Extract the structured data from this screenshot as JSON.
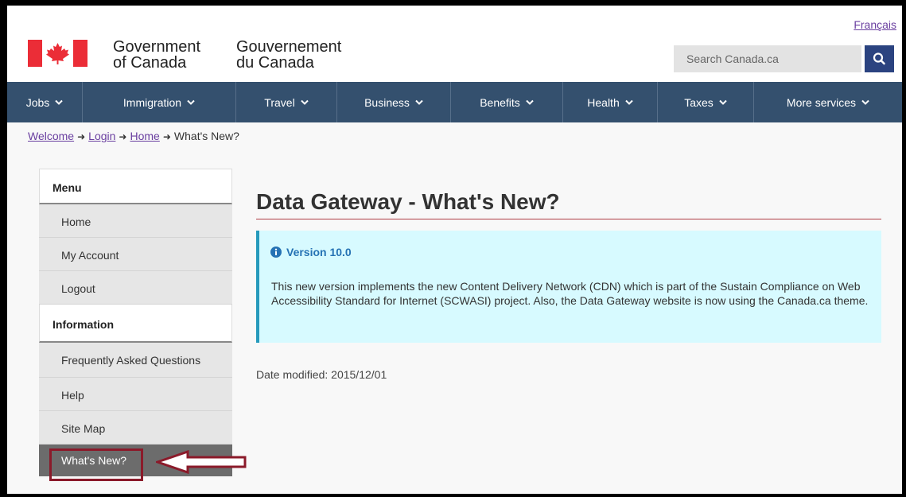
{
  "header": {
    "language_toggle": "Français",
    "signature_en": [
      "Government",
      "of Canada"
    ],
    "signature_fr": [
      "Gouvernement",
      "du Canada"
    ],
    "search_placeholder": "Search Canada.ca",
    "search_icon": "search-icon"
  },
  "nav": {
    "items": [
      "Jobs",
      "Immigration",
      "Travel",
      "Business",
      "Benefits",
      "Health",
      "Taxes",
      "More services"
    ]
  },
  "breadcrumb": {
    "links": [
      "Welcome",
      "Login",
      "Home"
    ],
    "current": "What's New?"
  },
  "sidebar": {
    "menu_heading": "Menu",
    "menu_items": [
      "Home",
      "My Account",
      "Logout"
    ],
    "info_heading": "Information",
    "info_items": [
      "Frequently Asked Questions",
      "Help",
      "Site Map",
      "What's New?"
    ]
  },
  "main": {
    "title": "Data Gateway - What's New?",
    "alert": {
      "icon": "info-circle-icon",
      "heading": "Version 10.0",
      "body": "This new version implements the new Content Delivery Network (CDN) which is part of the Sustain Compliance on Web Accessibility Standard for Internet (SCWASI) project. Also, the Data Gateway website is now using the Canada.ca theme."
    },
    "date_modified": "Date modified: 2015/12/01"
  },
  "colors": {
    "nav_bg": "#34506e",
    "flag_red": "#eb2d37",
    "search_button": "#2b4380",
    "alert_bg": "#d7faff",
    "alert_border": "#269abc",
    "title_rule": "#af3c43",
    "annotation_red": "#8b1a2a"
  }
}
